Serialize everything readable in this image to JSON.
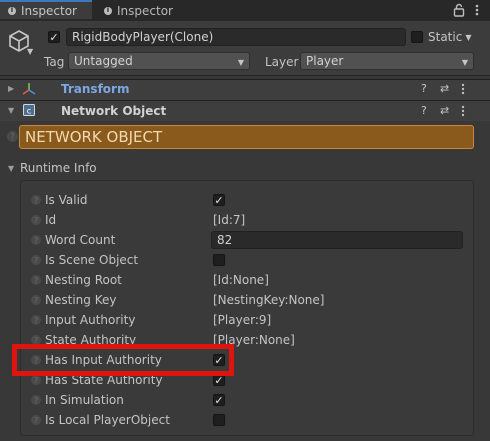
{
  "tabs": [
    {
      "label": "Inspector",
      "active": true
    },
    {
      "label": "Inspector",
      "active": false
    }
  ],
  "header": {
    "object_name": "RigidBodyPlayer(Clone)",
    "active_checked": true,
    "static_label": "Static",
    "tag_label": "Tag",
    "tag_value": "Untagged",
    "layer_label": "Layer",
    "layer_value": "Player"
  },
  "components": {
    "transform": {
      "title": "Transform"
    },
    "network_object": {
      "title": "Network Object"
    }
  },
  "banner": {
    "text": "NETWORK OBJECT",
    "color": "#8a5a1c"
  },
  "runtime": {
    "title": "Runtime Info",
    "rows": [
      {
        "label": "Is Valid",
        "type": "check",
        "checked": true
      },
      {
        "label": "Id",
        "type": "text",
        "value": "[Id:7]"
      },
      {
        "label": "Word Count",
        "type": "field",
        "value": "82"
      },
      {
        "label": "Is Scene Object",
        "type": "check",
        "checked": false
      },
      {
        "label": "Nesting Root",
        "type": "text",
        "value": "[Id:None]"
      },
      {
        "label": "Nesting Key",
        "type": "text",
        "value": "[NestingKey:None]"
      },
      {
        "label": "Input Authority",
        "type": "text",
        "value": "[Player:9]"
      },
      {
        "label": "State Authority",
        "type": "text",
        "value": "[Player:None]"
      },
      {
        "label": "Has Input Authority",
        "type": "check",
        "checked": true
      },
      {
        "label": "Has State Authority",
        "type": "check",
        "checked": true
      },
      {
        "label": "In Simulation",
        "type": "check",
        "checked": true
      },
      {
        "label": "Is Local PlayerObject",
        "type": "check",
        "checked": false
      }
    ]
  },
  "highlight_color": "#e0140e"
}
